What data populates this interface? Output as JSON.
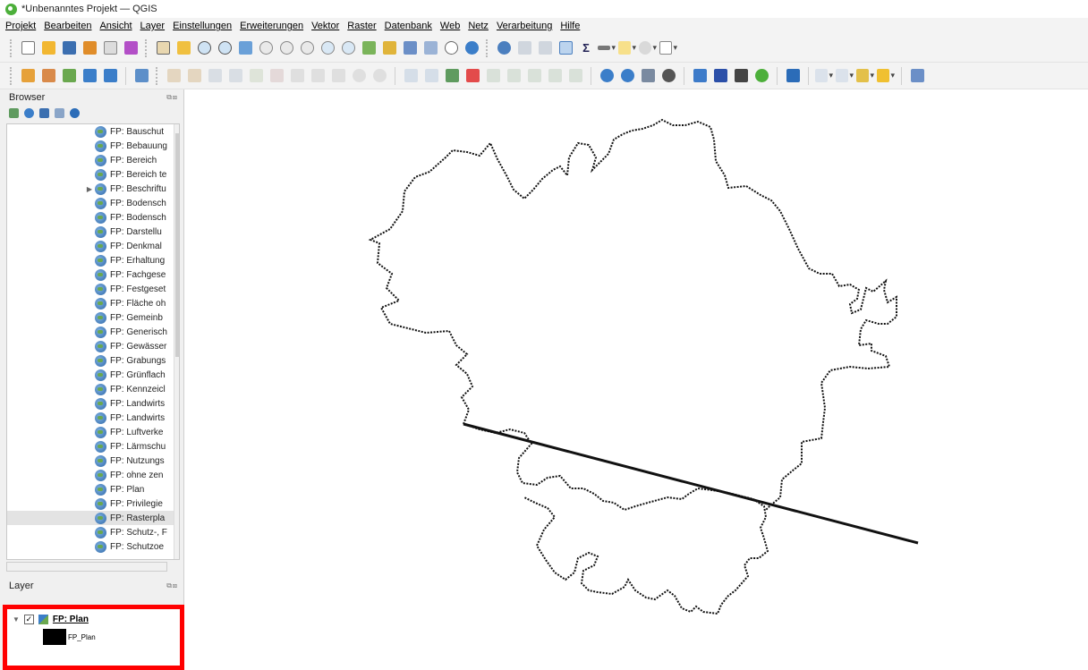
{
  "window": {
    "title": "*Unbenanntes Projekt — QGIS"
  },
  "menu": [
    "Projekt",
    "Bearbeiten",
    "Ansicht",
    "Layer",
    "Einstellungen",
    "Erweiterungen",
    "Vektor",
    "Raster",
    "Datenbank",
    "Web",
    "Netz",
    "Verarbeitung",
    "Hilfe"
  ],
  "browser": {
    "title": "Browser",
    "items": [
      "FP: Bauschut",
      "FP: Bebauung",
      "FP: Bereich",
      "FP: Bereich te",
      "FP: Beschriftu",
      "FP: Bodensch",
      "FP: Bodensch",
      "FP: Darstellu",
      "FP: Denkmal",
      "FP: Erhaltung",
      "FP: Fachgese",
      "FP: Festgeset",
      "FP: Fläche oh",
      "FP: Gemeinb",
      "FP: Generisch",
      "FP: Gewässer",
      "FP: Grabungs",
      "FP: Grünflach",
      "FP: Kennzeicl",
      "FP: Landwirts",
      "FP: Landwirts",
      "FP: Luftverke",
      "FP: Lärmschu",
      "FP: Nutzungs",
      "FP: ohne zen",
      "FP: Plan",
      "FP: Privilegie",
      "FP: Rasterpla",
      "FP: Schutz-, F",
      "FP: Schutzoe"
    ]
  },
  "layers": {
    "title": "Layer",
    "items": [
      {
        "name": "FP: Plan",
        "legend": "FP_Plan"
      }
    ]
  },
  "colors": {
    "highlight_box": "#ff0000",
    "accent": "#4caf3a"
  }
}
